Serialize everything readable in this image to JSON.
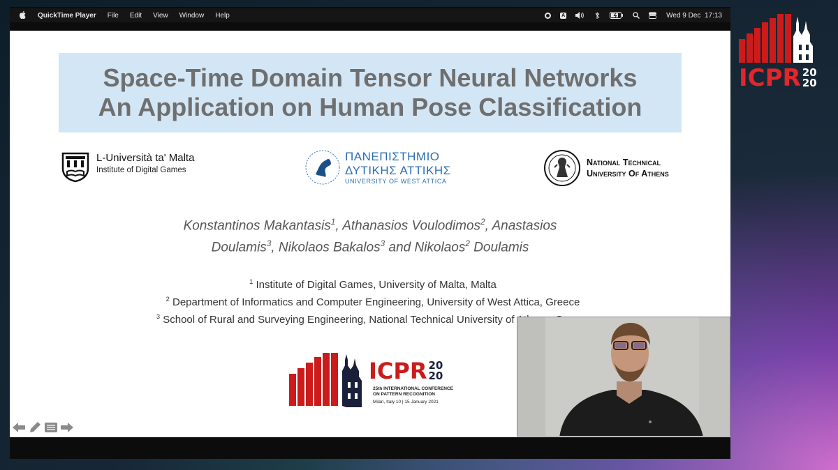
{
  "menubar": {
    "app_name": "QuickTime Player",
    "menus": [
      "File",
      "Edit",
      "View",
      "Window",
      "Help"
    ],
    "status_icons": [
      "screen-record-icon",
      "input-source-icon",
      "volume-icon",
      "bluetooth-off-icon",
      "battery-icon",
      "spotlight-search-icon",
      "control-center-icon"
    ],
    "input_source_letter": "A",
    "datetime": "Wed 9 Dec  17:13"
  },
  "slide": {
    "title_line1": "Space-Time Domain Tensor Neural Networks",
    "title_line2": "An Application on Human Pose Classification",
    "logos": {
      "malta_name": "L-Università ta' Malta",
      "malta_sub": "Institute of Digital Games",
      "uwa_line1": "ΠΑΝΕΠΙΣΤΗΜΙΟ",
      "uwa_line2": "ΔΥΤΙΚΗΣ ΑΤΤΙΚΗΣ",
      "uwa_line3": "UNIVERSITY OF WEST ATTICA",
      "ntua_line1": "National Technical",
      "ntua_line2": "University Of Athens"
    },
    "authors": {
      "a1": "Konstantinos Makantasis",
      "a1_sup": "1",
      "a2": "Athanasios Voulodimos",
      "a2_sup": "2",
      "a3_first": "Anastasios",
      "a3_last": "Doulamis",
      "a3_sup": "3",
      "a4": "Nikolaos Bakalos",
      "a4_sup": "3",
      "a5_first": "Nikolaos",
      "a5_sup": "2",
      "a5_last": "Doulamis"
    },
    "affiliations": [
      {
        "num": "1",
        "text": "Institute of Digital Games, University of Malta, Malta"
      },
      {
        "num": "2",
        "text": "Department of Informatics and Computer Engineering, University of West Attica, Greece"
      },
      {
        "num": "3",
        "text": "School of Rural and Surveying Engineering, National Technical University of Athens, Greece"
      }
    ],
    "conference": {
      "name": "ICPR",
      "year_top": "20",
      "year_bottom": "20",
      "sub1": "25th INTERNATIONAL CONFERENCE",
      "sub2": "ON PATTERN RECOGNITION",
      "sub3": "Milan, Italy 10 | 15 January 2021"
    },
    "nav_icons": [
      "arrow-left-icon",
      "pencil-icon",
      "menu-icon",
      "arrow-right-icon"
    ]
  },
  "corner_logo": {
    "name": "ICPR",
    "year_top": "20",
    "year_bottom": "20"
  },
  "colors": {
    "title_bg": "#d3e6f5",
    "icpr_red": "#cc1b1b",
    "uwa_blue": "#2b6fb3"
  }
}
